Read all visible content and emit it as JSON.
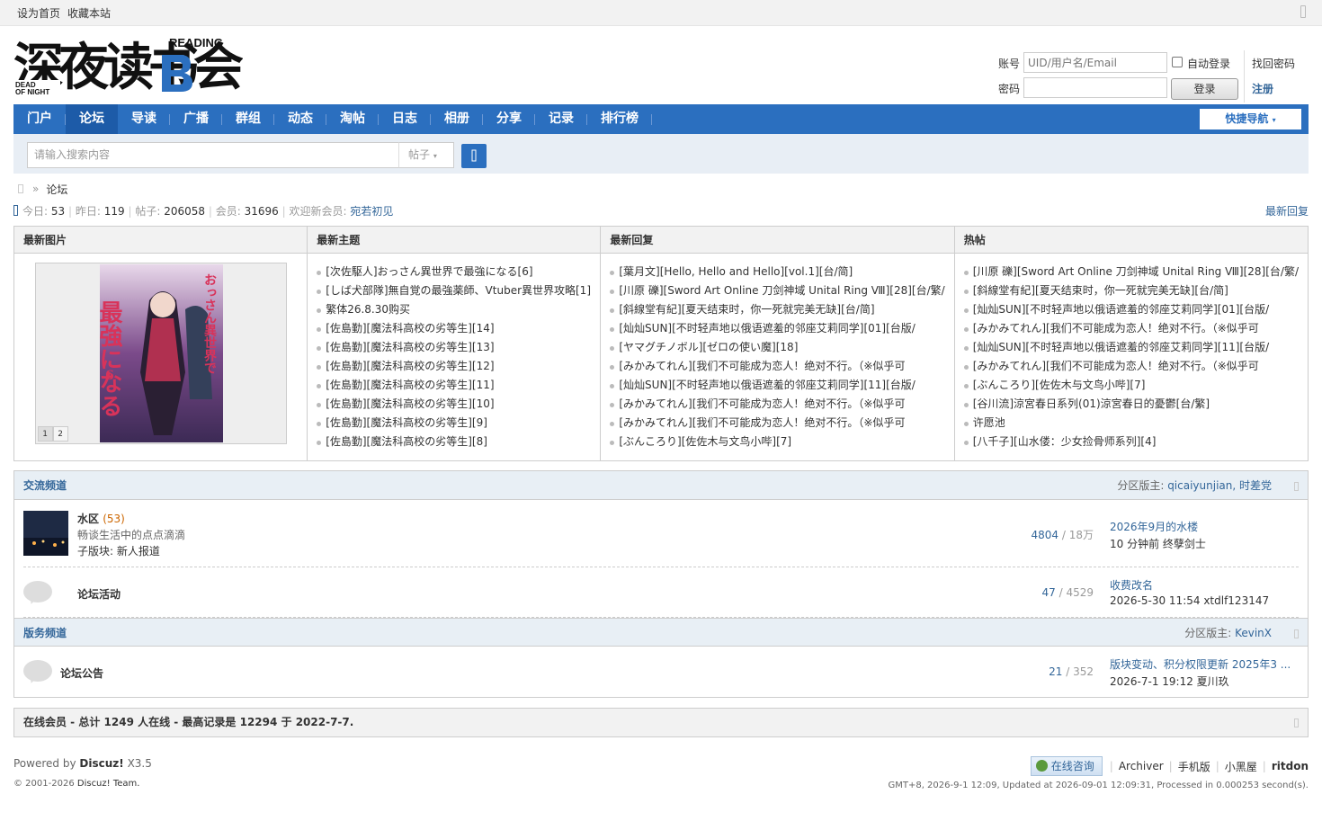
{
  "topbar": {
    "set_home": "设为首页",
    "bookmark": "收藏本站"
  },
  "logo": {
    "reading": "READING",
    "dead": "DEAD",
    "of_night": "OF NIGHT",
    "main": "深夜读书会"
  },
  "login": {
    "account_label": "账号",
    "account_placeholder": "UID/用户名/Email",
    "auto_login": "自动登录",
    "find_password": "找回密码",
    "password_label": "密码",
    "login_button": "登录",
    "register": "注册"
  },
  "nav": {
    "items": [
      "门户",
      "论坛",
      "导读",
      "广播",
      "群组",
      "动态",
      "淘帖",
      "日志",
      "相册",
      "分享",
      "记录",
      "排行榜"
    ],
    "active_index": 1,
    "quick_nav": "快捷导航"
  },
  "search": {
    "placeholder": "请输入搜索内容",
    "type": "帖子"
  },
  "breadcrumb": {
    "sep": "»",
    "current": "论坛"
  },
  "stats": {
    "today_label": "今日:",
    "today": "53",
    "yesterday_label": "昨日:",
    "yesterday": "119",
    "posts_label": "帖子:",
    "posts": "206058",
    "members_label": "会员:",
    "members": "31696",
    "welcome_label": "欢迎新会员:",
    "new_member": "宛若初见",
    "latest_reply_link": "最新回复"
  },
  "grid": {
    "pics": {
      "title": "最新图片",
      "pages": [
        "1",
        "2"
      ]
    },
    "new_topics": {
      "title": "最新主题",
      "items": [
        "[次佐駆人]おっさん異世界で最強になる[6]",
        "[しば犬部隊]無自覚の最強薬師、Vtuber異世界攻略[1]",
        "繁体26.8.30购买",
        "[佐島勤][魔法科高校の劣等生][14]",
        "[佐島勤][魔法科高校の劣等生][13]",
        "[佐島勤][魔法科高校の劣等生][12]",
        "[佐島勤][魔法科高校の劣等生][11]",
        "[佐島勤][魔法科高校の劣等生][10]",
        "[佐島勤][魔法科高校の劣等生][9]",
        "[佐島勤][魔法科高校の劣等生][8]"
      ]
    },
    "latest_replies": {
      "title": "最新回复",
      "items": [
        "[葉月文][Hello, Hello and Hello][vol.1][台/简]",
        "[川原 礫][Sword Art Online 刀剑神域 Unital Ring Ⅷ][28][台/繁/",
        "[斜線堂有紀][夏天结束时，你一死就完美无缺][台/简]",
        "[灿灿SUN][不时轻声地以俄语遮羞的邻座艾莉同学][01][台版/",
        "[ヤマグチノボル][ゼロの使い魔][18]",
        "[みかみてれん][我们不可能成为恋人！绝对不行。（※似乎可",
        "[灿灿SUN][不时轻声地以俄语遮羞的邻座艾莉同学][11][台版/",
        "[みかみてれん][我们不可能成为恋人！绝对不行。（※似乎可",
        "[みかみてれん][我们不可能成为恋人！绝对不行。（※似乎可",
        "[ぶんころり][佐佐木与文鸟小哔][7]"
      ]
    },
    "hot": {
      "title": "热帖",
      "items": [
        "[川原 礫][Sword Art Online 刀剑神域 Unital Ring Ⅷ][28][台/繁/",
        "[斜線堂有紀][夏天结束时，你一死就完美无缺][台/简]",
        "[灿灿SUN][不时轻声地以俄语遮羞的邻座艾莉同学][01][台版/",
        "[みかみてれん][我们不可能成为恋人！绝对不行。（※似乎可",
        "[灿灿SUN][不时轻声地以俄语遮羞的邻座艾莉同学][11][台版/",
        "[みかみてれん][我们不可能成为恋人！绝对不行。（※似乎可",
        "[ぶんころり][佐佐木与文鸟小哔][7]",
        "[谷川流]涼宮春日系列(01)涼宮春日的憂鬱[台/繁]",
        "许愿池",
        "[八千子][山水偻：少女捡骨师系列][4]"
      ]
    },
    "cover": {
      "title_vertical_1": "おっさん異世界で",
      "title_vertical_2": "最強になる",
      "volume": "6"
    }
  },
  "section1": {
    "title": "交流频道",
    "mod_label": "分区版主:",
    "mods": "qicaiyunjian, 时差党",
    "forums": [
      {
        "name": "水区",
        "today": "(53)",
        "desc": "畅谈生活中的点点滴滴",
        "sub": "子版块: 新人报道",
        "threads": "4804",
        "posts": "18万",
        "last_title": "2026年9月的水楼",
        "last_meta": "10 分钟前 终孽剑士"
      },
      {
        "name": "论坛活动",
        "threads": "47",
        "posts": "4529",
        "last_title": "收费改名",
        "last_meta": "2026-5-30 11:54 xtdlf123147"
      }
    ]
  },
  "section2": {
    "title": "版务频道",
    "mod_label": "分区版主:",
    "mods": "KevinX",
    "forums": [
      {
        "name": "论坛公告",
        "threads": "21",
        "posts": "352",
        "last_title": "版块变动、积分权限更新 2025年3 ...",
        "last_meta": "2026-7-1 19:12 夏川玖"
      }
    ]
  },
  "online": {
    "text": "在线会员 - 总计 1249 人在线 - 最高记录是 12294 于 2022-7-7."
  },
  "footer": {
    "powered": "Powered by",
    "brand": "Discuz!",
    "version": "X3.5",
    "copyright_pre": "© 2001-2026",
    "copyright_link": "Discuz! Team.",
    "chat": "在线咨询",
    "links": [
      "Archiver",
      "手机版",
      "小黑屋"
    ],
    "site": "ritdon",
    "info": "GMT+8, 2026-9-1 12:09, Updated at 2026-09-01 12:09:31, Processed in 0.000253 second(s)."
  },
  "colors": {
    "brand_blue": "#2b6fbf",
    "link": "#369"
  }
}
